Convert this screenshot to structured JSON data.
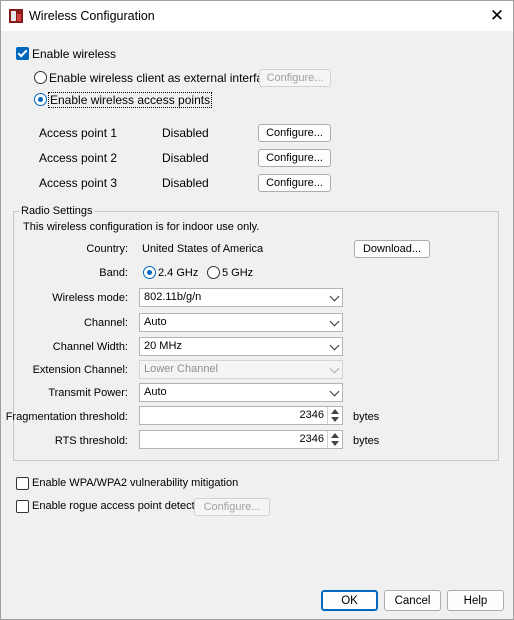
{
  "window": {
    "title": "Wireless Configuration"
  },
  "enable_wireless": {
    "label": "Enable wireless",
    "checked": true
  },
  "mode": {
    "client_label": "Enable wireless client as external interface",
    "client_configure": "Configure...",
    "ap_label": "Enable wireless access points",
    "selected": "ap"
  },
  "access_points": [
    {
      "name": "Access point 1",
      "status": "Disabled",
      "button": "Configure..."
    },
    {
      "name": "Access point 2",
      "status": "Disabled",
      "button": "Configure..."
    },
    {
      "name": "Access point 3",
      "status": "Disabled",
      "button": "Configure..."
    }
  ],
  "radio": {
    "group_title": "Radio Settings",
    "notice": "This wireless configuration is for indoor use only.",
    "country_label": "Country:",
    "country_value": "United States of America",
    "download_label": "Download...",
    "band_label": "Band:",
    "band_24": "2.4 GHz",
    "band_5": "5 GHz",
    "band_selected": "2.4",
    "wireless_mode_label": "Wireless mode:",
    "wireless_mode_value": "802.11b/g/n",
    "channel_label": "Channel:",
    "channel_value": "Auto",
    "channel_width_label": "Channel Width:",
    "channel_width_value": "20 MHz",
    "ext_channel_label": "Extension Channel:",
    "ext_channel_value": "Lower Channel",
    "transmit_power_label": "Transmit Power:",
    "transmit_power_value": "Auto",
    "frag_label": "Fragmentation threshold:",
    "frag_value": "2346",
    "frag_unit": "bytes",
    "rts_label": "RTS threshold:",
    "rts_value": "2346",
    "rts_unit": "bytes"
  },
  "wpa_mitigation": {
    "label": "Enable WPA/WPA2 vulnerability mitigation",
    "checked": false
  },
  "rogue_ap": {
    "label": "Enable rogue access point detection",
    "checked": false,
    "configure": "Configure..."
  },
  "footer": {
    "ok": "OK",
    "cancel": "Cancel",
    "help": "Help"
  },
  "colors": {
    "accent": "#0067c0"
  }
}
